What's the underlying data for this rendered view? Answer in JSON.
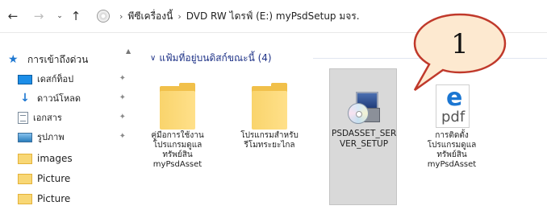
{
  "address_bar": {
    "back_icon": "back-arrow-icon",
    "forward_icon": "forward-arrow-icon",
    "recent_icon": "chevron-down-icon",
    "up_icon": "up-arrow-icon",
    "drive_icon": "dvd-drive-icon",
    "breadcrumbs": [
      "พีซีเครื่องนี้",
      "DVD RW ไดรฟ์ (E:) myPsdSetup มจร."
    ]
  },
  "sidebar": {
    "items": [
      {
        "label": "การเข้าถึงด่วน",
        "icon": "star-icon",
        "pinned": false
      },
      {
        "label": "เดสก์ท็อป",
        "icon": "desktop-icon",
        "pinned": true
      },
      {
        "label": "ดาวน์โหลด",
        "icon": "download-icon",
        "pinned": true
      },
      {
        "label": "เอกสาร",
        "icon": "document-icon",
        "pinned": true
      },
      {
        "label": "รูปภาพ",
        "icon": "pictures-icon",
        "pinned": true
      },
      {
        "label": "images",
        "icon": "folder-icon",
        "pinned": false
      },
      {
        "label": "Picture",
        "icon": "folder-icon",
        "pinned": false
      },
      {
        "label": "Picture",
        "icon": "folder-icon",
        "pinned": false
      }
    ]
  },
  "content": {
    "group_header": "แฟ้มที่อยู่บนดิสก์ขณะนี้ (4)",
    "tiles": [
      {
        "name": "คู่มือการใช้งาน โปรแกรมดูแล ทรัพย์สิน myPsdAsset",
        "icon": "folder-icon",
        "selected": false
      },
      {
        "name": "โปรแกรมสำหรับ รีโมทระยะไกล",
        "icon": "folder-icon",
        "selected": false
      },
      {
        "name": "PSDASSET_SER VER_SETUP",
        "icon": "setup-installer-icon",
        "selected": true
      },
      {
        "name": "การติดตั้ง โปรแกรมดูแล ทรัพย์สิน myPsdAsset",
        "icon": "pdf-file-icon",
        "selected": false
      }
    ]
  },
  "callout": {
    "label": "1",
    "fill": "#fde9d0",
    "stroke": "#c0392b"
  },
  "colors": {
    "selection": "#d9d9d9",
    "header_text": "#1e3287",
    "accent": "#1f78d1"
  }
}
